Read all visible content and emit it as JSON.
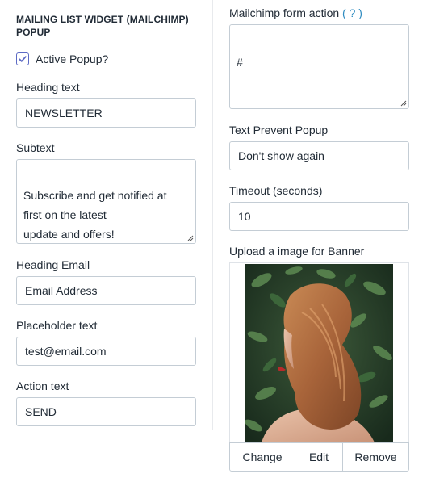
{
  "left": {
    "section_title": "MAILING LIST WIDGET (MAILCHIMP) POPUP",
    "active_popup": {
      "label": "Active Popup?",
      "checked": true
    },
    "heading_text": {
      "label": "Heading text",
      "value": "NEWSLETTER"
    },
    "subtext": {
      "label": "Subtext",
      "value": "Subscribe and get notified at\nfirst on the latest\nupdate and offers!"
    },
    "heading_email": {
      "label": "Heading Email",
      "value": "Email Address"
    },
    "placeholder_text": {
      "label": "Placeholder text",
      "value": "test@email.com"
    },
    "action_text": {
      "label": "Action text",
      "value": "SEND"
    }
  },
  "right": {
    "form_action": {
      "label": "Mailchimp form action",
      "help": "( ? )",
      "value": "#"
    },
    "prevent_popup": {
      "label": "Text Prevent Popup",
      "value": "Don't show again"
    },
    "timeout": {
      "label": "Timeout (seconds)",
      "value": "10"
    },
    "banner": {
      "label": "Upload a image for Banner"
    },
    "buttons": {
      "change": "Change",
      "edit": "Edit",
      "remove": "Remove"
    }
  },
  "colors": {
    "accent": "#5c6ac4",
    "link": "#2e8bc0",
    "border": "#c4cdd5"
  }
}
